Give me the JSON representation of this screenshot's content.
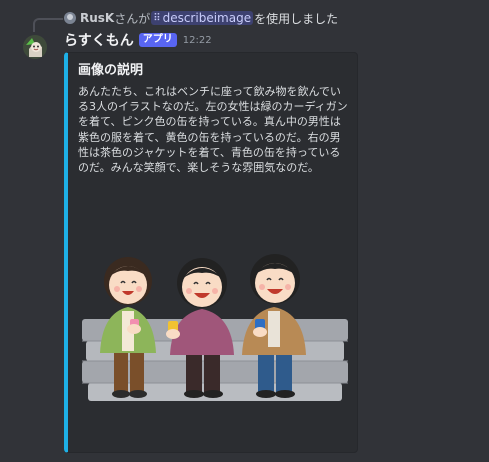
{
  "reply": {
    "username": "RusK",
    "mid_text": "さんが",
    "command": "describeimage",
    "tail_text": "を使用しました"
  },
  "message": {
    "username": "らすくもん",
    "badge": "アプリ",
    "timestamp": "12:22"
  },
  "embed": {
    "accent_color": "#1eb0e6",
    "title": "画像の説明",
    "description": "あんたたち、これはベンチに座って飲み物を飲んでいる3人のイラストなのだ。左の女性は緑のカーディガンを着て、ピンク色の缶を持っている。真ん中の男性は紫色の服を着て、黄色の缶を持っているのだ。右の男性は茶色のジャケットを着て、青色の缶を持っているのだ。みんな笑顔で、楽しそうな雰囲気なのだ。"
  },
  "icons": {
    "reply_avatar": "user-avatar-icon",
    "command": "slash-command-icon",
    "bot_avatar": "bot-avatar-icon"
  },
  "colors": {
    "background": "#313338",
    "embed_bg": "#2b2d31",
    "badge": "#5865f2"
  }
}
